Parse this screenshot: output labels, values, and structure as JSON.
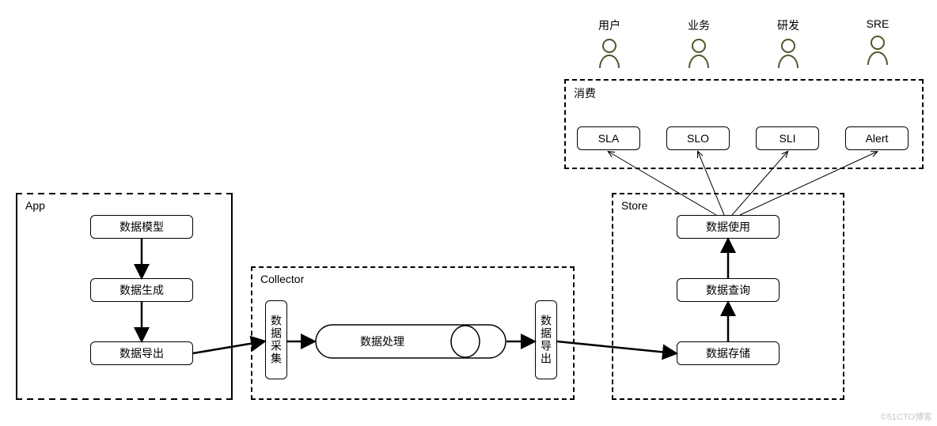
{
  "panels": {
    "app": "App",
    "collector": "Collector",
    "store": "Store",
    "consume": "消费"
  },
  "nodes": {
    "dataModel": "数据模型",
    "dataGen": "数据生成",
    "dataOutApp": "数据导出",
    "dataCollect": "数据采集",
    "dataProcess": "数据处理",
    "dataOutCol": "数据导出",
    "dataStore": "数据存储",
    "dataQuery": "数据查询",
    "dataUse": "数据使用",
    "sla": "SLA",
    "slo": "SLO",
    "sli": "SLI",
    "alert": "Alert"
  },
  "personas": {
    "user": "用户",
    "biz": "业务",
    "dev": "研发",
    "sre": "SRE"
  },
  "watermark": "©51CTO博客"
}
